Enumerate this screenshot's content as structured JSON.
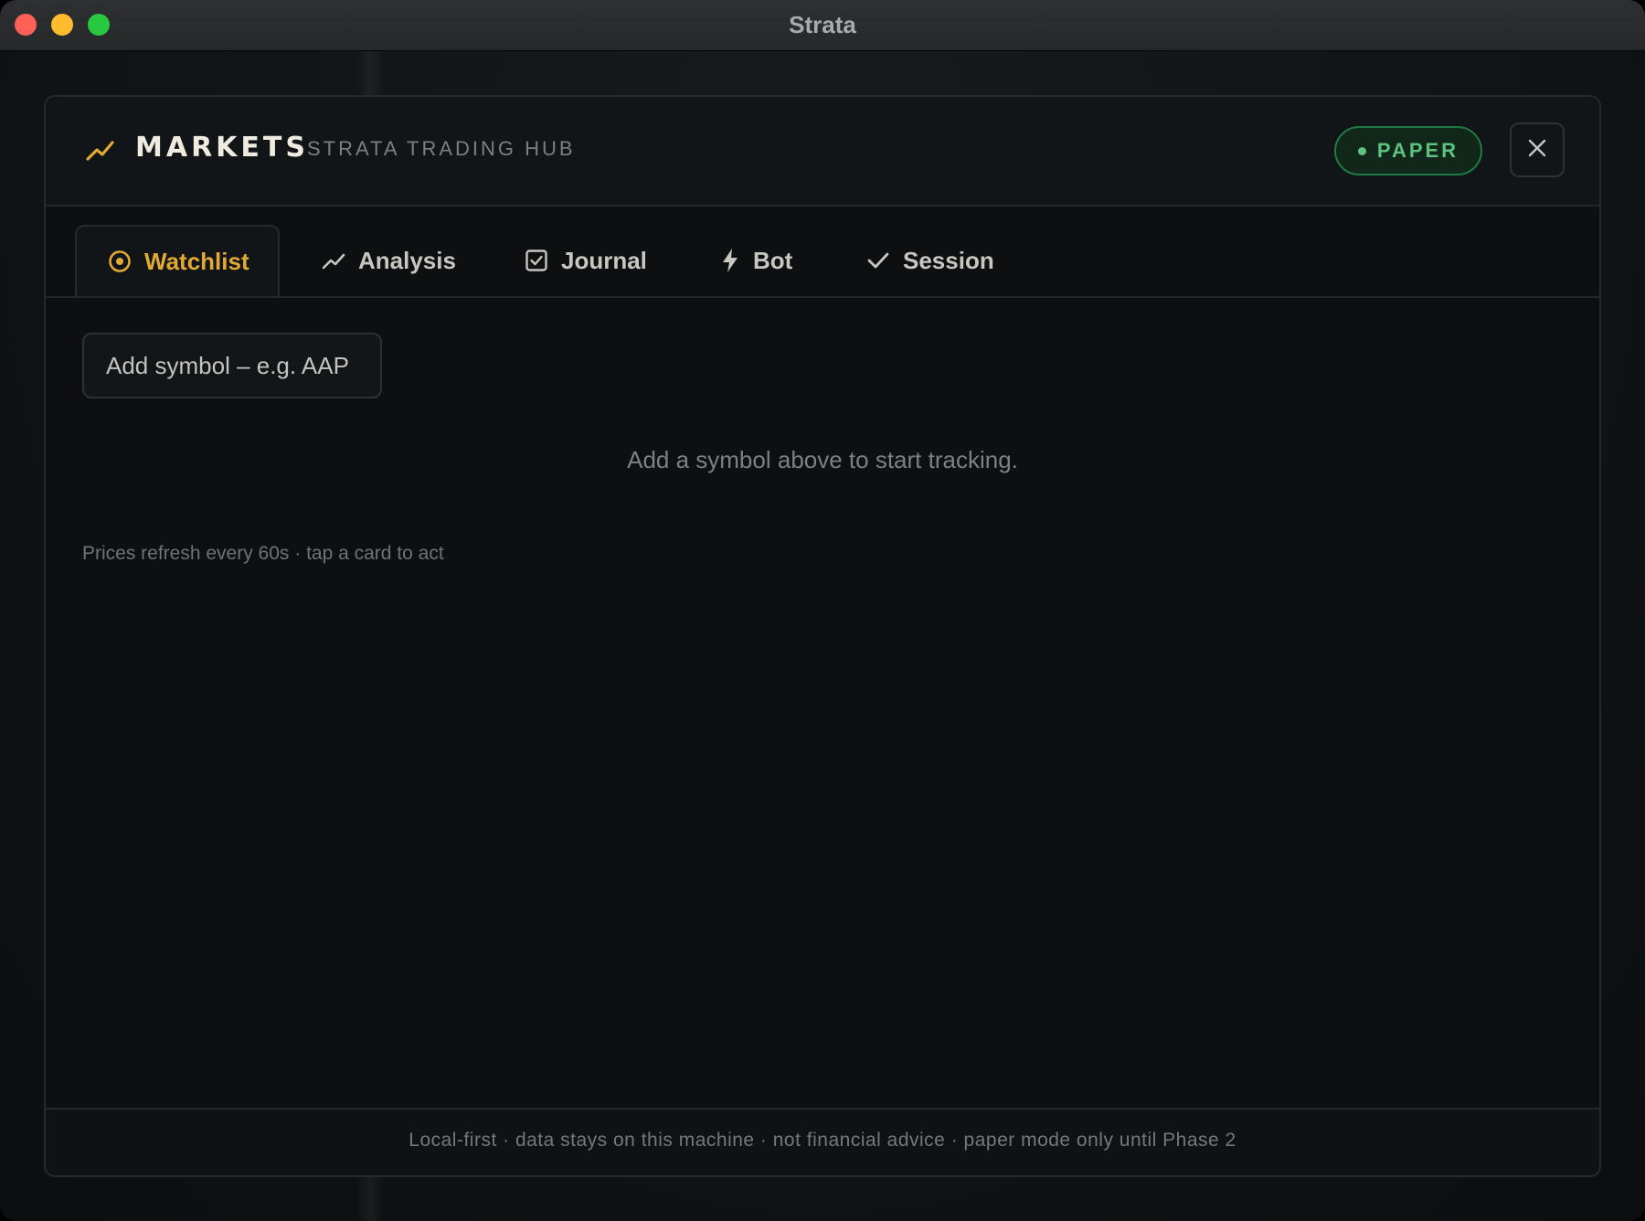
{
  "window": {
    "title": "Strata",
    "controls": [
      "close",
      "minimize",
      "maximize"
    ]
  },
  "header": {
    "icon": "trend-up-icon",
    "title": "MARKETS",
    "subtitle": "STRATA TRADING HUB",
    "mode_badge": "PAPER",
    "close_icon": "close-icon"
  },
  "tabs": [
    {
      "label": "Watchlist",
      "icon": "target-icon",
      "active": true
    },
    {
      "label": "Analysis",
      "icon": "trend-up-icon",
      "active": false
    },
    {
      "label": "Journal",
      "icon": "checkbox-icon",
      "active": false
    },
    {
      "label": "Bot",
      "icon": "lightning-icon",
      "active": false
    },
    {
      "label": "Session",
      "icon": "checkmark-icon",
      "active": false
    }
  ],
  "watchlist": {
    "input_placeholder": "Add symbol – e.g. AAP",
    "empty_message": "Add a symbol above to start tracking.",
    "refresh_note": "Prices refresh every 60s · tap a card to act"
  },
  "footer": {
    "text": "Local-first · data stays on this machine · not financial advice · paper mode only until Phase 2"
  },
  "colors": {
    "accent": "#e2a935",
    "paper_green": "#5ec27e",
    "background": "#0d0f11"
  }
}
